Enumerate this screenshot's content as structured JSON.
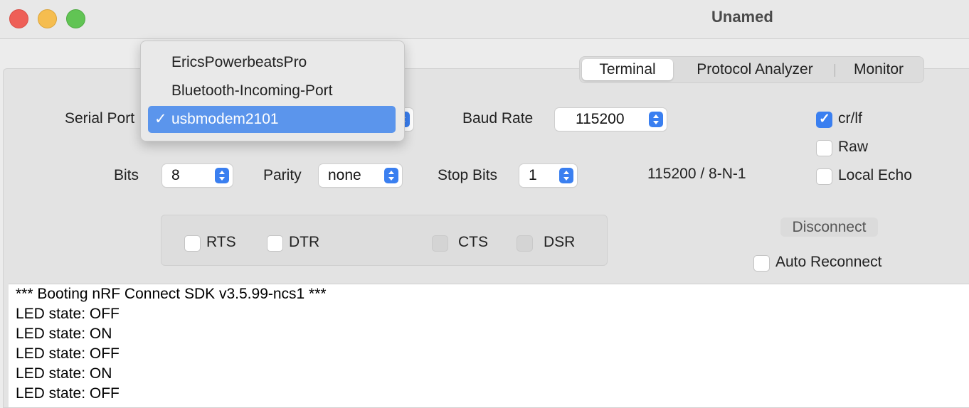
{
  "window": {
    "title": "Unamed"
  },
  "tabs": [
    {
      "label": "Terminal",
      "active": true
    },
    {
      "label": "Protocol Analyzer",
      "active": false
    },
    {
      "label": "Monitor",
      "active": false
    }
  ],
  "serial": {
    "port_label": "Serial Port",
    "baud_label": "Baud Rate",
    "baud_value": "115200",
    "bits_label": "Bits",
    "bits_value": "8",
    "parity_label": "Parity",
    "parity_value": "none",
    "stop_label": "Stop Bits",
    "stop_value": "1",
    "summary": "115200 / 8-N-1"
  },
  "port_dropdown": {
    "options": [
      "EricsPowerbeatsPro",
      "Bluetooth-Incoming-Port",
      "usbmodem2101"
    ],
    "selected": "usbmodem2101",
    "check_glyph": "✓"
  },
  "options": {
    "crlf": {
      "label": "cr/lf",
      "checked": true
    },
    "raw": {
      "label": "Raw",
      "checked": false
    },
    "local_echo": {
      "label": "Local Echo",
      "checked": false
    }
  },
  "signals": {
    "rts": "RTS",
    "dtr": "DTR",
    "cts": "CTS",
    "dsr": "DSR"
  },
  "connection": {
    "disconnect_label": "Disconnect",
    "auto_reconnect_label": "Auto Reconnect"
  },
  "terminal": {
    "lines": [
      "*** Booting nRF Connect SDK v3.5.99-ncs1 ***",
      "LED state: OFF",
      "LED state: ON",
      "LED state: OFF",
      "LED state: ON",
      "LED state: OFF"
    ]
  },
  "colors": {
    "accent": "#3a7ff0",
    "selection": "#5b95ec"
  }
}
